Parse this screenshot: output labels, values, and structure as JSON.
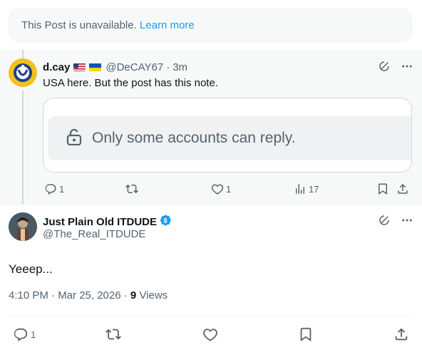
{
  "unavailable": {
    "text": "This Post is unavailable.",
    "link": "Learn more"
  },
  "reply": {
    "name": "d.cay",
    "handle": "@DeCAY67",
    "time": "3m",
    "text": "USA here. But the post has this note.",
    "note_text": "Only some accounts can reply.",
    "replies": "1",
    "likes": "1",
    "views": "17"
  },
  "main_post": {
    "name": "Just Plain Old ITDUDE",
    "handle": "@The_Real_ITDUDE",
    "text": "Yeeep...",
    "timestamp": "4:10 PM · Mar 25, 2026 · ",
    "views_count": "9",
    "views_label": "Views",
    "replies": "1"
  },
  "colors": {
    "accent": "#1d9bf0",
    "muted": "#536471",
    "text": "#0f1419"
  }
}
